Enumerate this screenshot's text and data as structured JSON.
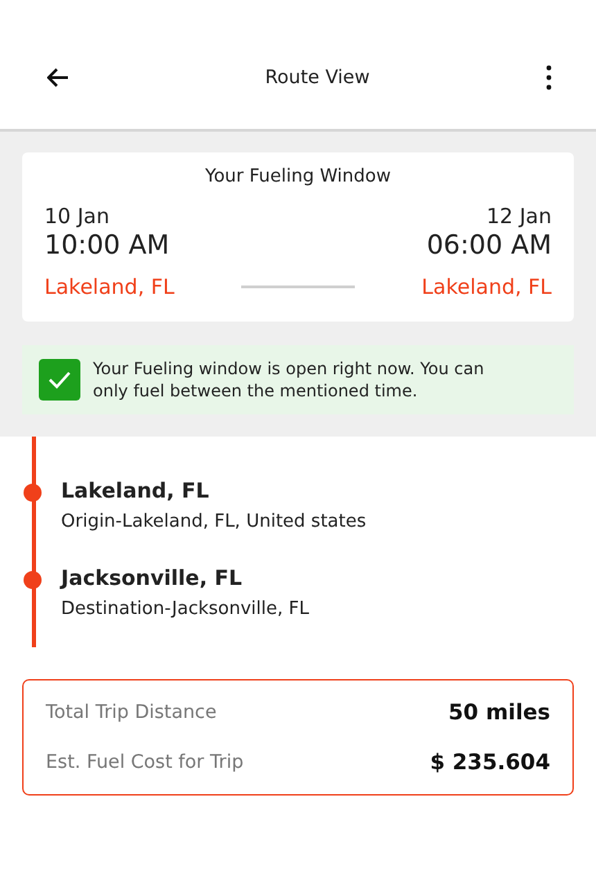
{
  "header": {
    "title": "Route View"
  },
  "fueling_window": {
    "title": "Your Fueling Window",
    "start": {
      "date": "10 Jan",
      "time": "10:00 AM",
      "place": "Lakeland, FL"
    },
    "end": {
      "date": "12 Jan",
      "time": "06:00 AM",
      "place": "Lakeland, FL"
    }
  },
  "notice": {
    "text": "Your Fueling window is open right now. You can only fuel between the mentioned time."
  },
  "stops": [
    {
      "name": "Lakeland, FL",
      "detail": "Origin-Lakeland, FL, United states"
    },
    {
      "name": "Jacksonville, FL",
      "detail": "Destination-Jacksonville, FL"
    }
  ],
  "summary": [
    {
      "label": "Total Trip Distance",
      "value": "50 miles"
    },
    {
      "label": "Est. Fuel Cost for Trip",
      "value": "$ 235.604"
    }
  ]
}
